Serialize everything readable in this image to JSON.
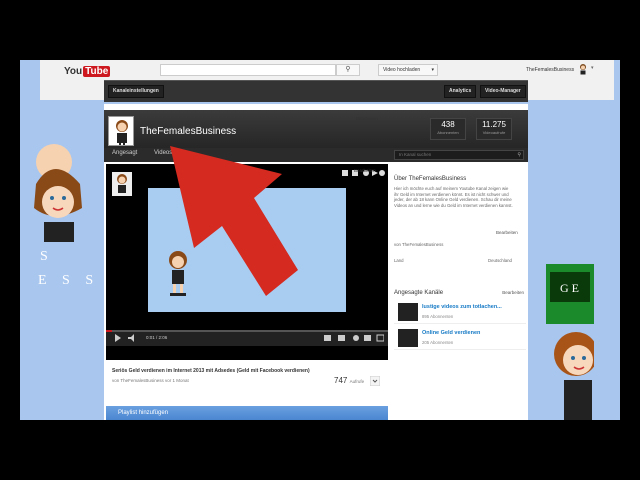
{
  "topbar": {
    "logo_you": "You",
    "logo_tube": "Tube",
    "upload_label": "Video hochladen",
    "user_name": "TheFemalesBusiness"
  },
  "channel_bar": {
    "settings_label": "Kanaleinstellungen",
    "analytics_label": "Analytics",
    "manager_label": "Video-Manager"
  },
  "channel": {
    "title": "TheFemalesBusiness",
    "subscribers_value": "438",
    "subscribers_label": "Abonnenten",
    "views_value": "11.275",
    "views_label": "Videoaufrufe",
    "tabs": [
      "Angesagt",
      "Videos"
    ],
    "search_placeholder": "In Kanal suchen"
  },
  "video": {
    "edit_label": "Bearbeiten",
    "time": "0:01 / 2:06",
    "progress": 0.02,
    "title": "Seriös Geld verdienen im Internet 2013 mit Adsedes (Geld mit Facebook verdienen)",
    "byline": "von TheFemalesBusiness vor 1 Monat",
    "views_count": "747",
    "views_unit": "Aufrufe",
    "playlist_label": "Playlist hinzufügen"
  },
  "sidebar": {
    "about_title": "Über TheFemalesBusiness",
    "about_edit": "Bearbeiten",
    "about_text": "Hier ich möchte euch auf meinem Youtube Kanal zeigen wie ihr Geld im Internet verdienen könnt. Es ist nicht schwer und jeder, der ab 18 kann Online Geld verdienen. Schau dir meine Videos an und lerne wie du Geld im Internet verdienen kannst.",
    "channel_link": "von TheFemalesBusiness",
    "country_label": "Land",
    "country_value": "Deutschland",
    "featured_title": "Angesagte Kanäle",
    "featured_edit": "Bearbeiten",
    "featured": [
      {
        "name": "lustige videos zum totlachen...",
        "subs": "895 Abonnenten"
      },
      {
        "name": "Online Geld verdienen",
        "subs": "205 Abonnenten"
      }
    ]
  },
  "left_banner": {
    "letters_1": "S",
    "letters_2": "E S S"
  },
  "right_banner": {
    "text": "G E"
  },
  "colors": {
    "background": "#a8c6ee",
    "arrow": "#d42a1f",
    "yt_red": "#cc181e",
    "link_blue": "#167ac6"
  }
}
